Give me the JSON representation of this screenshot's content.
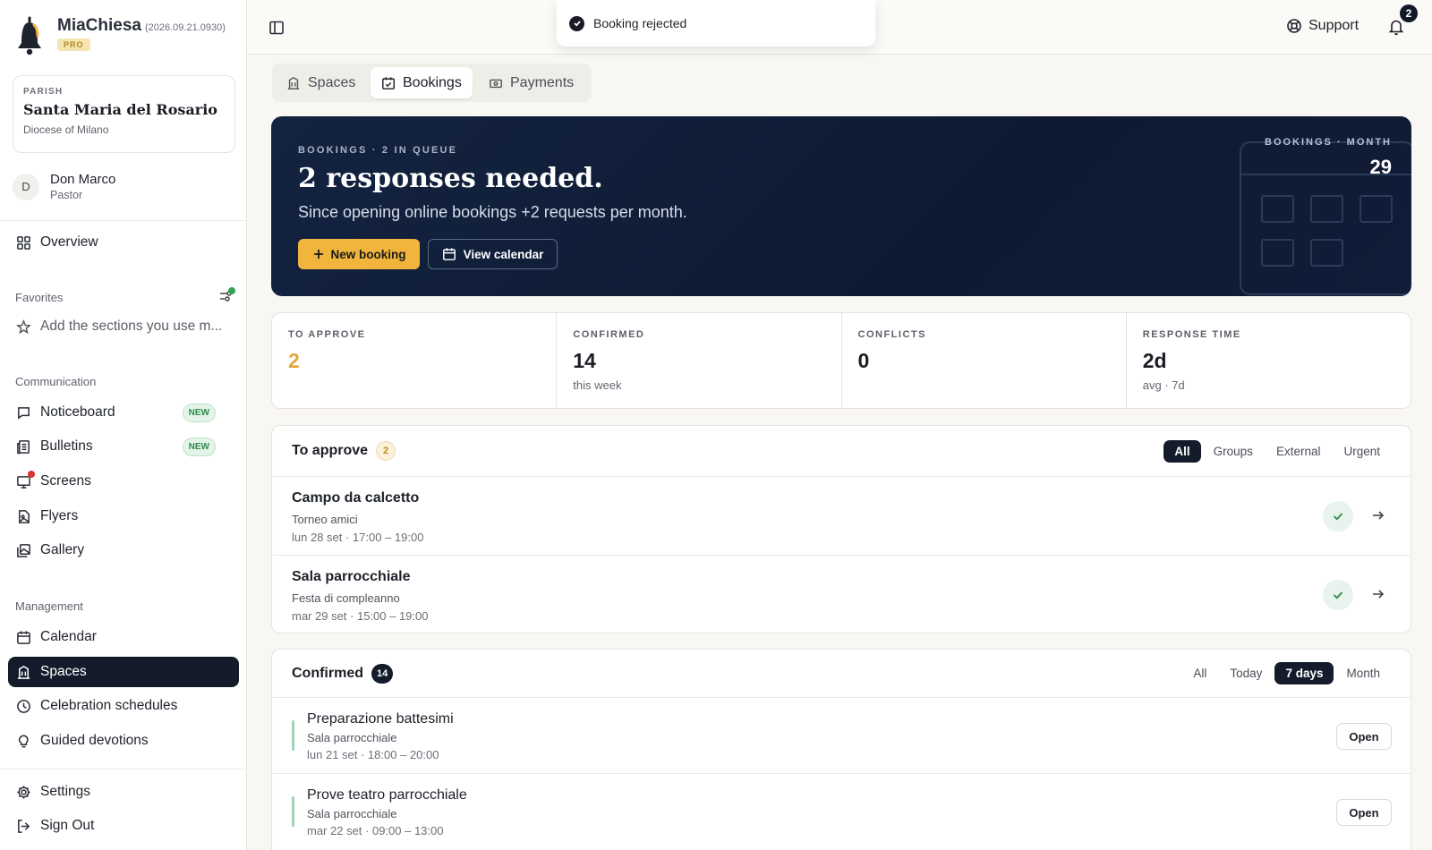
{
  "brand": {
    "name": "MiaChiesa",
    "version": "(2026.09.21.0930)",
    "plan": "PRO"
  },
  "parish": {
    "kicker": "PARISH",
    "name": "Santa Maria del Rosario",
    "diocese": "Diocese of Milano"
  },
  "user": {
    "initial": "D",
    "name": "Don Marco",
    "role": "Pastor"
  },
  "sidebar": {
    "overview": "Overview",
    "favorites_label": "Favorites",
    "favorites_hint": "Add the sections you use m...",
    "communication_label": "Communication",
    "communication": [
      {
        "label": "Noticeboard",
        "badge": "NEW"
      },
      {
        "label": "Bulletins",
        "badge": "NEW"
      },
      {
        "label": "Screens"
      },
      {
        "label": "Flyers"
      },
      {
        "label": "Gallery"
      }
    ],
    "management_label": "Management",
    "management": [
      {
        "label": "Calendar"
      },
      {
        "label": "Spaces"
      },
      {
        "label": "Celebration schedules"
      },
      {
        "label": "Guided devotions"
      }
    ],
    "settings": "Settings",
    "sign_out": "Sign Out"
  },
  "toast": {
    "message": "Booking rejected"
  },
  "topbar": {
    "support": "Support",
    "notifications_count": "2"
  },
  "tabs": [
    {
      "label": "Spaces"
    },
    {
      "label": "Bookings"
    },
    {
      "label": "Payments"
    }
  ],
  "hero": {
    "kicker": "BOOKINGS · 2 IN QUEUE",
    "title": "2 responses needed.",
    "subtitle": "Since opening online bookings +2 requests per month.",
    "primary_button": "New booking",
    "secondary_button": "View calendar",
    "stat_label": "BOOKINGS · MONTH",
    "stat_value": "29",
    "accent": "#f1b53d"
  },
  "stats": [
    {
      "label": "TO APPROVE",
      "value": "2",
      "sub": ""
    },
    {
      "label": "CONFIRMED",
      "value": "14",
      "sub": "this week"
    },
    {
      "label": "CONFLICTS",
      "value": "0",
      "sub": ""
    },
    {
      "label": "RESPONSE TIME",
      "value": "2d",
      "sub": "avg · 7d"
    }
  ],
  "to_approve": {
    "title": "To approve",
    "count": "2",
    "filters": [
      "All",
      "Groups",
      "External",
      "Urgent"
    ],
    "rows": [
      {
        "title": "Campo da calcetto",
        "sub": "Torneo amici",
        "time": "lun 28 set · 17:00 – 19:00"
      },
      {
        "title": "Sala parrocchiale",
        "sub": "Festa di compleanno",
        "time": "mar 29 set · 15:00 – 19:00"
      }
    ]
  },
  "confirmed": {
    "title": "Confirmed",
    "count": "14",
    "filters": [
      "All",
      "Today",
      "7 days",
      "Month"
    ],
    "open_label": "Open",
    "rows": [
      {
        "title": "Preparazione battesimi",
        "sub": "Sala parrocchiale",
        "time": "lun 21 set · 18:00 – 20:00"
      },
      {
        "title": "Prove teatro parrocchiale",
        "sub": "Sala parrocchiale",
        "time": "mar 22 set · 09:00 – 13:00"
      }
    ]
  }
}
